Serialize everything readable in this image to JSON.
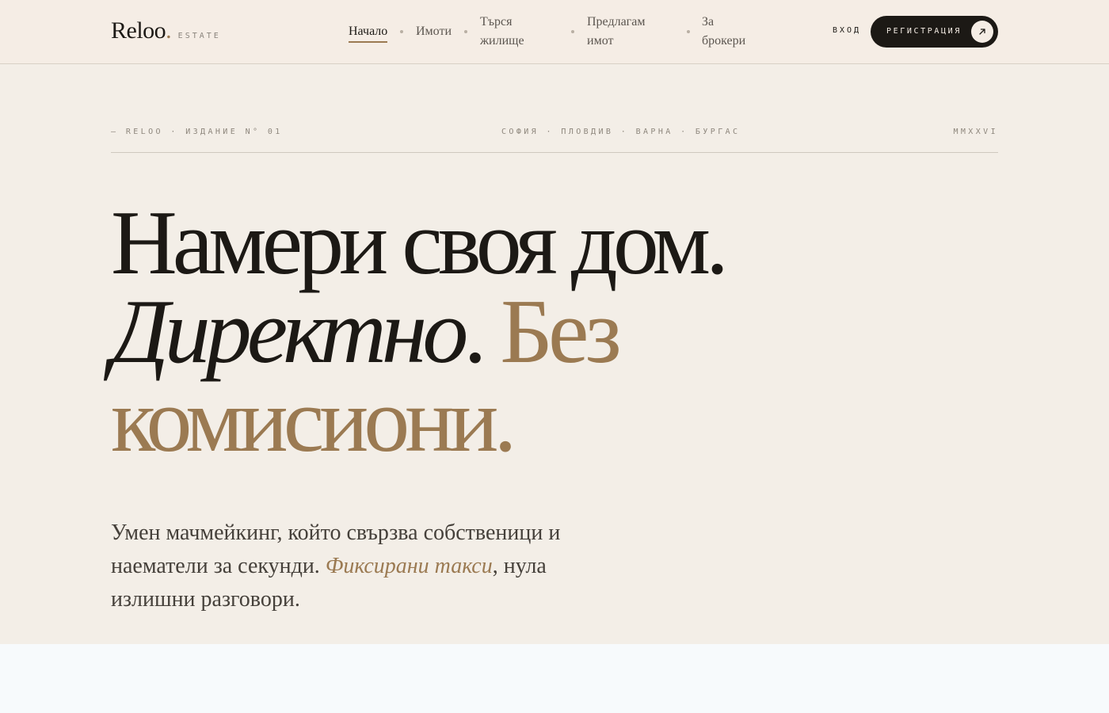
{
  "brand": {
    "name": "Reloo",
    "dot": ".",
    "sub": "ESTATE"
  },
  "nav": {
    "items": [
      {
        "label": "Начало",
        "active": true
      },
      {
        "label": "Имоти"
      },
      {
        "label": "Търся жилище"
      },
      {
        "label": "Предлагам имот"
      },
      {
        "label": "За брокери"
      }
    ]
  },
  "auth": {
    "login_label": "ВХОД",
    "register_label": "РЕГИСТРАЦИЯ",
    "register_icon": "arrow-up-right-icon"
  },
  "edition": {
    "left": "— RELOO · ИЗДАНИЕ N° 01",
    "center": "СОФИЯ · ПЛОВДИВ · ВАРНА · БУРГАС",
    "right": "MMXXVI"
  },
  "headline": {
    "line1": "Намери своя дом.",
    "italic_word": "Директно",
    "period": ". ",
    "accent_part1": "Без",
    "accent_part2": "комисиони."
  },
  "lead": {
    "part1": "Умен мачмейкинг, който свързва собственици и наематели за секунди. ",
    "accent": "Фиксирани такси",
    "part2": ", нула излишни разговори."
  },
  "colors": {
    "accent": "#9b7a52",
    "ink": "#1c1915",
    "paper": "#f3eee7",
    "header": "#f5ede5"
  }
}
